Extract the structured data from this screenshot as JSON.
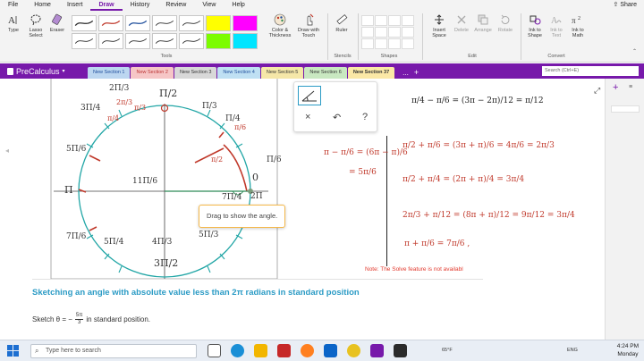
{
  "menubar": {
    "items": [
      "File",
      "Home",
      "Insert",
      "Draw",
      "History",
      "Review",
      "View",
      "Help"
    ],
    "active": "Draw",
    "share_label": "Share"
  },
  "ribbon": {
    "type_label": "Type",
    "lasso_label": "Lasso Select",
    "eraser_label": "Eraser",
    "tools_group": "Tools",
    "color_label": "Color & Thickness",
    "draw_touch_label": "Draw with Touch",
    "ruler_label": "Ruler",
    "stencils_group": "Stencils",
    "shapes_group": "Shapes",
    "insert_space_label": "Insert Space",
    "delete_label": "Delete",
    "arrange_label": "Arrange",
    "rotate_label": "Rotate",
    "edit_group": "Edit",
    "ink_shape_label": "Ink to Shape",
    "ink_text_label": "Ink to Text",
    "ink_math_label": "Ink to Math",
    "convert_group": "Convert",
    "pen_colors": [
      "#2b2b2b",
      "#c0392b",
      "#1f4e9c",
      "#2b2b2b",
      "#2b2b2b",
      "#ffff00",
      "#ff00ff",
      "#2b2b2b",
      "#2b2b2b",
      "#2b2b2b",
      "#2b2b2b",
      "#2b2b2b",
      "#7cfc00",
      "#00e5ff"
    ]
  },
  "notebook": {
    "title": "PreCalculus",
    "sections": [
      {
        "label": "New Section 1",
        "color": "#bcd6f0"
      },
      {
        "label": "New Section 2",
        "color": "#f6c6c6"
      },
      {
        "label": "New Section 3",
        "color": "#d8d8d8"
      },
      {
        "label": "New Section 4",
        "color": "#bfe0f3"
      },
      {
        "label": "New Section 5",
        "color": "#f5e7a8"
      },
      {
        "label": "New Section 6",
        "color": "#c9e8c1"
      },
      {
        "label": "New Section 37",
        "color": "#fbe8a6",
        "active": true
      }
    ],
    "more_label": "...",
    "add_label": "+",
    "search_placeholder": "Search (Ctrl+E)"
  },
  "float_toolbar": {
    "close_symbol": "×",
    "undo_symbol": "↶",
    "help_symbol": "?"
  },
  "tooltip": "Drag to show the angle.",
  "note": "Note: The Solve feature is not availabl",
  "heading": "Sketching an angle with absolute value less than 2π radians in standard position",
  "sketch": {
    "prefix": "Sketch θ = −",
    "num": "5π",
    "den": "3",
    "suffix": "in standard position."
  },
  "circle_labels": {
    "top": "Π/2",
    "bottom": "3Π/2",
    "left": "Π",
    "right": "0",
    "right2": "2Π",
    "pi3": "Π/3",
    "pi4": "Π/4",
    "pi6": "Π/6",
    "two_pi3": "2Π/3",
    "three_pi4": "3Π/4",
    "five_pi6": "5Π/6",
    "seven_pi6": "7Π/6",
    "five_pi4": "5Π/4",
    "four_pi3": "4Π/3",
    "five_pi3": "5Π/3",
    "seven_pi4": "7Π/4",
    "eleven_pi6": "11Π/6",
    "r_pi4": "π/4",
    "r_pi3": "π/3",
    "r_pi6": "π/6",
    "r_2pi3": "2π/3",
    "r_pi2": "π/2"
  },
  "math": {
    "line1": "π/4 − π/6 = (3π − 2π)/12 = π/12",
    "left1": "π − π/6 = (6π − π)/6",
    "left2": "= 5π/6",
    "line2": "π/2 + π/6 = (3π + π)/6 = 4π/6 = 2π/3",
    "line3": "π/2 + π/4 = (2π + π)/4 = 3π/4",
    "line4": "2π/3 + π/12 = (8π + π)/12 = 9π/12 = 3π/4",
    "line5": "π + π/6 = 7π/6 ,"
  },
  "taskbar": {
    "search_placeholder": "Type here to search",
    "weather": "65°F",
    "lang": "ENG",
    "time": "4:24 PM",
    "day": "Monday"
  }
}
